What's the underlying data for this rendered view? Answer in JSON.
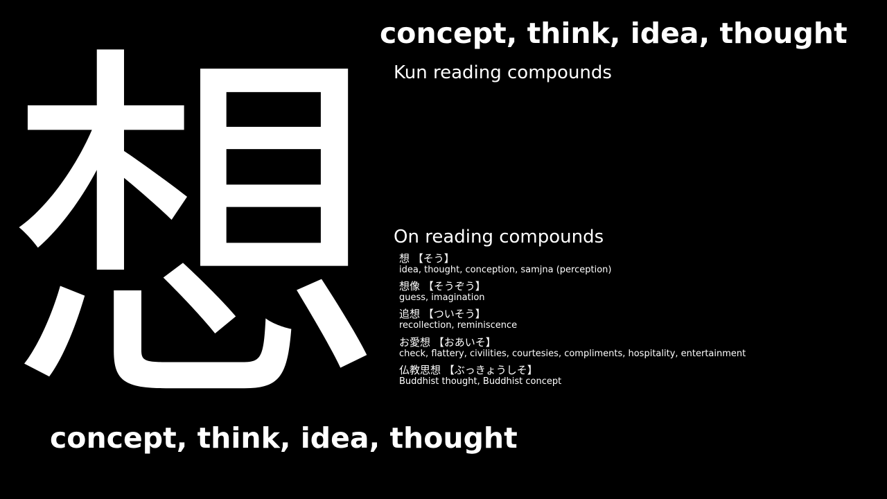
{
  "kanji": "想",
  "meaning_top": "concept, think, idea, thought",
  "meaning_bottom": "concept, think, idea, thought",
  "kun_heading": "Kun reading compounds",
  "on_heading": "On reading compounds",
  "on_compounds": [
    {
      "word": "想 【そう】",
      "meaning": "idea, thought, conception, samjna (perception)"
    },
    {
      "word": "想像 【そうぞう】",
      "meaning": "guess, imagination"
    },
    {
      "word": "追想 【ついそう】",
      "meaning": "recollection, reminiscence"
    },
    {
      "word": "お愛想 【おあいそ】",
      "meaning": "check, flattery, civilities, courtesies, compliments, hospitality, entertainment"
    },
    {
      "word": "仏教思想 【ぶっきょうしそ】",
      "meaning": "Buddhist thought, Buddhist concept"
    }
  ]
}
